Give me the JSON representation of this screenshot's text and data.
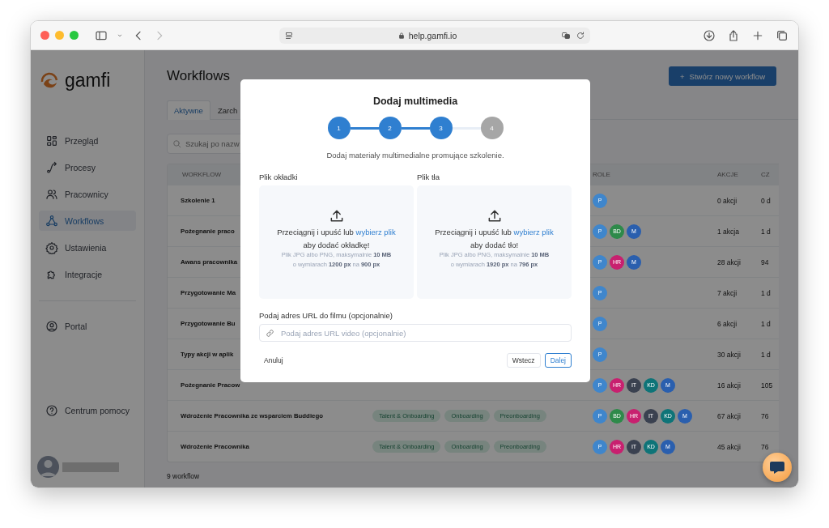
{
  "browser": {
    "url": "help.gamfi.io"
  },
  "sidebar": {
    "logo": "gamfi",
    "items": [
      {
        "label": "Przegląd",
        "selected": false
      },
      {
        "label": "Procesy",
        "selected": false
      },
      {
        "label": "Pracownicy",
        "selected": false
      },
      {
        "label": "Workflows",
        "selected": true
      },
      {
        "label": "Ustawienia",
        "selected": false
      },
      {
        "label": "Integracje",
        "selected": false
      }
    ],
    "secondary_items": [
      {
        "label": "Portal",
        "selected": false
      }
    ],
    "help": "Centrum pomocy"
  },
  "main": {
    "title": "Workflows",
    "create_button": {
      "icon": "+",
      "label": "Stwórz nowy workflow"
    },
    "tabs": [
      {
        "label": "Aktywne",
        "selected": true
      },
      {
        "label": "Zarch",
        "selected": false
      }
    ],
    "search": {
      "placeholder": "Szukaj po nazw"
    },
    "table": {
      "columns": [
        "WORKFLOW",
        "ROLE",
        "AKCJE",
        "CZ"
      ],
      "rows": [
        {
          "workflow": "Szkolenie 1",
          "tags": [],
          "roles": [
            {
              "initials": "P",
              "color": "#3f86cc"
            }
          ],
          "actions": "0 akcji",
          "column_5": "0 d"
        },
        {
          "workflow": "Pożegnanie praco",
          "tags": [],
          "roles": [
            {
              "initials": "P",
              "color": "#3f86cc"
            },
            {
              "initials": "BD",
              "color": "#2e8a4a"
            },
            {
              "initials": "M",
              "color": "#2a5fae"
            }
          ],
          "actions": "1 akcja",
          "column_5": "1 d"
        },
        {
          "workflow": "Awans pracownika",
          "tags": [],
          "roles": [
            {
              "initials": "P",
              "color": "#3f86cc"
            },
            {
              "initials": "HR",
              "color": "#c8206f"
            },
            {
              "initials": "M",
              "color": "#2a5fae"
            }
          ],
          "actions": "28 akcji",
          "column_5": "94"
        },
        {
          "workflow": "Przygotowanie Ma",
          "tags": [],
          "roles": [
            {
              "initials": "P",
              "color": "#3f86cc"
            }
          ],
          "actions": "7 akcji",
          "column_5": "1 d"
        },
        {
          "workflow": "Przygotowanie Bu",
          "tags": [],
          "roles": [
            {
              "initials": "P",
              "color": "#3f86cc"
            }
          ],
          "actions": "6 akcji",
          "column_5": "1 d"
        },
        {
          "workflow": "Typy akcji w aplik",
          "tags": [],
          "roles": [
            {
              "initials": "P",
              "color": "#3f86cc"
            }
          ],
          "actions": "30 akcji",
          "column_5": "1 d"
        },
        {
          "workflow": "Pożegnanie Pracow",
          "tags": [],
          "roles": [
            {
              "initials": "P",
              "color": "#3f86cc"
            },
            {
              "initials": "HR",
              "color": "#c8206f"
            },
            {
              "initials": "IT",
              "color": "#3a4150"
            },
            {
              "initials": "KD",
              "color": "#0e7478"
            },
            {
              "initials": "M",
              "color": "#2a5fae"
            }
          ],
          "actions": "16 akcji",
          "column_5": "105"
        },
        {
          "workflow": "Wdrożenie Pracownika ze wsparciem Buddiego",
          "tags": [
            "Talent & Onboarding",
            "Onboarding",
            "Preonboarding"
          ],
          "roles": [
            {
              "initials": "P",
              "color": "#3f86cc"
            },
            {
              "initials": "BD",
              "color": "#2e8a4a"
            },
            {
              "initials": "HR",
              "color": "#c8206f"
            },
            {
              "initials": "IT",
              "color": "#3a4150"
            },
            {
              "initials": "KD",
              "color": "#0e7478"
            },
            {
              "initials": "M",
              "color": "#2a5fae"
            }
          ],
          "actions": "67 akcji",
          "column_5": "76"
        },
        {
          "workflow": "Wdrożenie Pracownika",
          "tags": [
            "Talent & Onboarding",
            "Onboarding",
            "Preonboarding"
          ],
          "roles": [
            {
              "initials": "P",
              "color": "#3f86cc"
            },
            {
              "initials": "HR",
              "color": "#c8206f"
            },
            {
              "initials": "IT",
              "color": "#3a4150"
            },
            {
              "initials": "KD",
              "color": "#0e7478"
            },
            {
              "initials": "M",
              "color": "#2a5fae"
            }
          ],
          "actions": "45 akcji",
          "column_5": "76"
        }
      ]
    },
    "footer": "9 workflow"
  },
  "modal": {
    "title": "Dodaj multimedia",
    "steps": [
      {
        "label": "1",
        "completed": true
      },
      {
        "label": "2",
        "completed": true
      },
      {
        "label": "3",
        "completed": true
      },
      {
        "label": "4",
        "completed": false
      }
    ],
    "description": "Dodaj materiały multimedialne promujące szkolenie.",
    "uploads": [
      {
        "label": "Plik okładki",
        "prompt": "Przeciągnij i upuść lub ",
        "link": "wybierz plik",
        "purpose": "aby dodać okładkę!",
        "hint_1": "Plik JPG albo PNG, maksymalnie **10 MB**",
        "hint_2": "o wymiarach **1200 px** na **900 px**"
      },
      {
        "label": "Plik tła",
        "prompt": "Przeciągnij i upuść lub ",
        "link": "wybierz plik",
        "purpose": "aby dodać tło!",
        "hint_1": "Plik JPG albo PNG, maksymalnie **10 MB**",
        "hint_2": "o wymiarach **1920 px** na **796 px**"
      }
    ],
    "video_label": "Podaj adres URL do filmu (opcjonalnie)",
    "video_placeholder": "Podaj adres URL video (opcjonalnie)",
    "cancel": "Anuluj",
    "back": "Wstecz",
    "next": "Dalej"
  }
}
